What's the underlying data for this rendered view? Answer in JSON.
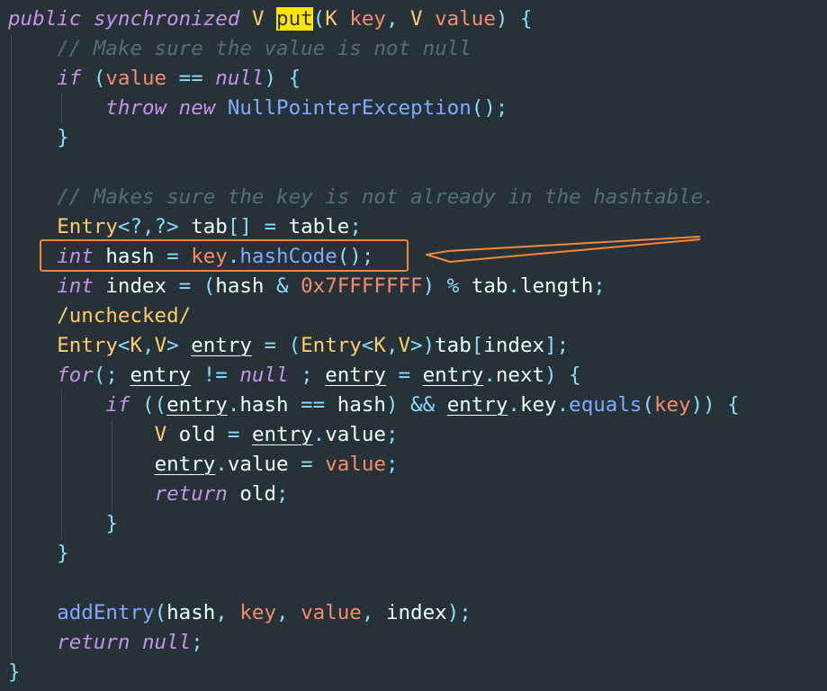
{
  "editor": {
    "theme_background": "#263238",
    "annotation_color": "#f5863d",
    "lines": [
      [
        [
          "kw",
          "public"
        ],
        [
          "pl",
          " "
        ],
        [
          "kw",
          "synchronized"
        ],
        [
          "pl",
          " "
        ],
        [
          "ty",
          "V"
        ],
        [
          "pl",
          " "
        ],
        [
          "hl",
          "put"
        ],
        [
          "pu",
          "("
        ],
        [
          "ty",
          "K"
        ],
        [
          "pl",
          " "
        ],
        [
          "pa",
          "key"
        ],
        [
          "pu",
          ","
        ],
        [
          "pl",
          " "
        ],
        [
          "ty",
          "V"
        ],
        [
          "pl",
          " "
        ],
        [
          "pa",
          "value"
        ],
        [
          "pu",
          ")"
        ],
        [
          "pl",
          " "
        ],
        [
          "pu",
          "{"
        ]
      ],
      [
        [
          "pl",
          "    "
        ],
        [
          "cm",
          "// Make sure the value is not null"
        ]
      ],
      [
        [
          "pl",
          "    "
        ],
        [
          "kw",
          "if"
        ],
        [
          "pl",
          " "
        ],
        [
          "pu",
          "("
        ],
        [
          "pa",
          "value"
        ],
        [
          "pl",
          " "
        ],
        [
          "pu",
          "=="
        ],
        [
          "pl",
          " "
        ],
        [
          "kw",
          "null"
        ],
        [
          "pu",
          ")"
        ],
        [
          "pl",
          " "
        ],
        [
          "pu",
          "{"
        ]
      ],
      [
        [
          "pl",
          "        "
        ],
        [
          "kw",
          "throw"
        ],
        [
          "pl",
          " "
        ],
        [
          "kw",
          "new"
        ],
        [
          "pl",
          " "
        ],
        [
          "fn",
          "NullPointerException"
        ],
        [
          "pu",
          "();"
        ]
      ],
      [
        [
          "pl",
          "    "
        ],
        [
          "pu",
          "}"
        ]
      ],
      [],
      [
        [
          "pl",
          "    "
        ],
        [
          "cm",
          "// Makes sure the key is not already in the hashtable."
        ]
      ],
      [
        [
          "pl",
          "    "
        ],
        [
          "ty",
          "Entry"
        ],
        [
          "pu",
          "<?,?>"
        ],
        [
          "pl",
          " tab"
        ],
        [
          "pu",
          "[]"
        ],
        [
          "pl",
          " "
        ],
        [
          "pu",
          "="
        ],
        [
          "pl",
          " table"
        ],
        [
          "pu",
          ";"
        ]
      ],
      [
        [
          "pl",
          "    "
        ],
        [
          "kw",
          "int"
        ],
        [
          "pl",
          " hash "
        ],
        [
          "pu",
          "="
        ],
        [
          "pl",
          " "
        ],
        [
          "pa",
          "key"
        ],
        [
          "pu",
          "."
        ],
        [
          "fn",
          "hashCode"
        ],
        [
          "pu",
          "();"
        ]
      ],
      [
        [
          "pl",
          "    "
        ],
        [
          "kw",
          "int"
        ],
        [
          "pl",
          " index "
        ],
        [
          "pu",
          "="
        ],
        [
          "pl",
          " "
        ],
        [
          "pu",
          "("
        ],
        [
          "pl",
          "hash "
        ],
        [
          "pu",
          "&"
        ],
        [
          "pl",
          " "
        ],
        [
          "pa",
          "0x7FFFFFFF"
        ],
        [
          "pu",
          ")"
        ],
        [
          "pl",
          " "
        ],
        [
          "pu",
          "%"
        ],
        [
          "pl",
          " tab"
        ],
        [
          "pu",
          "."
        ],
        [
          "pl",
          "length"
        ],
        [
          "pu",
          ";"
        ]
      ],
      [
        [
          "pl",
          "    "
        ],
        [
          "ty",
          "/unchecked/"
        ]
      ],
      [
        [
          "pl",
          "    "
        ],
        [
          "ty",
          "Entry"
        ],
        [
          "pu",
          "<"
        ],
        [
          "ty",
          "K"
        ],
        [
          "pu",
          ","
        ],
        [
          "ty",
          "V"
        ],
        [
          "pu",
          ">"
        ],
        [
          "pl",
          " "
        ],
        [
          "un",
          "entry"
        ],
        [
          "pl",
          " "
        ],
        [
          "pu",
          "="
        ],
        [
          "pl",
          " "
        ],
        [
          "pu",
          "("
        ],
        [
          "ty",
          "Entry"
        ],
        [
          "pu",
          "<"
        ],
        [
          "ty",
          "K"
        ],
        [
          "pu",
          ","
        ],
        [
          "ty",
          "V"
        ],
        [
          "pu",
          ">)"
        ],
        [
          "pl",
          "tab"
        ],
        [
          "pu",
          "["
        ],
        [
          "pl",
          "index"
        ],
        [
          "pu",
          "];"
        ]
      ],
      [
        [
          "pl",
          "    "
        ],
        [
          "kw",
          "for"
        ],
        [
          "pu",
          "(;"
        ],
        [
          "pl",
          " "
        ],
        [
          "un",
          "entry"
        ],
        [
          "pl",
          " "
        ],
        [
          "pu",
          "!="
        ],
        [
          "pl",
          " "
        ],
        [
          "kw",
          "null"
        ],
        [
          "pl",
          " "
        ],
        [
          "pu",
          ";"
        ],
        [
          "pl",
          " "
        ],
        [
          "un",
          "entry"
        ],
        [
          "pl",
          " "
        ],
        [
          "pu",
          "="
        ],
        [
          "pl",
          " "
        ],
        [
          "un",
          "entry"
        ],
        [
          "pu",
          "."
        ],
        [
          "pl",
          "next"
        ],
        [
          "pu",
          ")"
        ],
        [
          "pl",
          " "
        ],
        [
          "pu",
          "{"
        ]
      ],
      [
        [
          "pl",
          "        "
        ],
        [
          "kw",
          "if"
        ],
        [
          "pl",
          " "
        ],
        [
          "pu",
          "(("
        ],
        [
          "un",
          "entry"
        ],
        [
          "pu",
          "."
        ],
        [
          "pl",
          "hash "
        ],
        [
          "pu",
          "=="
        ],
        [
          "pl",
          " hash"
        ],
        [
          "pu",
          ")"
        ],
        [
          "pl",
          " "
        ],
        [
          "pu",
          "&&"
        ],
        [
          "pl",
          " "
        ],
        [
          "un",
          "entry"
        ],
        [
          "pu",
          "."
        ],
        [
          "pl",
          "key"
        ],
        [
          "pu",
          "."
        ],
        [
          "fn",
          "equals"
        ],
        [
          "pu",
          "("
        ],
        [
          "pa",
          "key"
        ],
        [
          "pu",
          "))"
        ],
        [
          "pl",
          " "
        ],
        [
          "pu",
          "{"
        ]
      ],
      [
        [
          "pl",
          "            "
        ],
        [
          "ty",
          "V"
        ],
        [
          "pl",
          " old "
        ],
        [
          "pu",
          "="
        ],
        [
          "pl",
          " "
        ],
        [
          "un",
          "entry"
        ],
        [
          "pu",
          "."
        ],
        [
          "pl",
          "value"
        ],
        [
          "pu",
          ";"
        ]
      ],
      [
        [
          "pl",
          "            "
        ],
        [
          "un",
          "entry"
        ],
        [
          "pu",
          "."
        ],
        [
          "pl",
          "value "
        ],
        [
          "pu",
          "="
        ],
        [
          "pl",
          " "
        ],
        [
          "pa",
          "value"
        ],
        [
          "pu",
          ";"
        ]
      ],
      [
        [
          "pl",
          "            "
        ],
        [
          "kw",
          "return"
        ],
        [
          "pl",
          " old"
        ],
        [
          "pu",
          ";"
        ]
      ],
      [
        [
          "pl",
          "        "
        ],
        [
          "pu",
          "}"
        ]
      ],
      [
        [
          "pl",
          "    "
        ],
        [
          "pu",
          "}"
        ]
      ],
      [],
      [
        [
          "pl",
          "    "
        ],
        [
          "fn",
          "addEntry"
        ],
        [
          "pu",
          "("
        ],
        [
          "pl",
          "hash"
        ],
        [
          "pu",
          ","
        ],
        [
          "pl",
          " "
        ],
        [
          "pa",
          "key"
        ],
        [
          "pu",
          ","
        ],
        [
          "pl",
          " "
        ],
        [
          "pa",
          "value"
        ],
        [
          "pu",
          ","
        ],
        [
          "pl",
          " index"
        ],
        [
          "pu",
          ");"
        ]
      ],
      [
        [
          "pl",
          "    "
        ],
        [
          "kw",
          "return"
        ],
        [
          "pl",
          " "
        ],
        [
          "kw",
          "null"
        ],
        [
          "pu",
          ";"
        ]
      ],
      [
        [
          "pu",
          "}"
        ]
      ]
    ]
  }
}
